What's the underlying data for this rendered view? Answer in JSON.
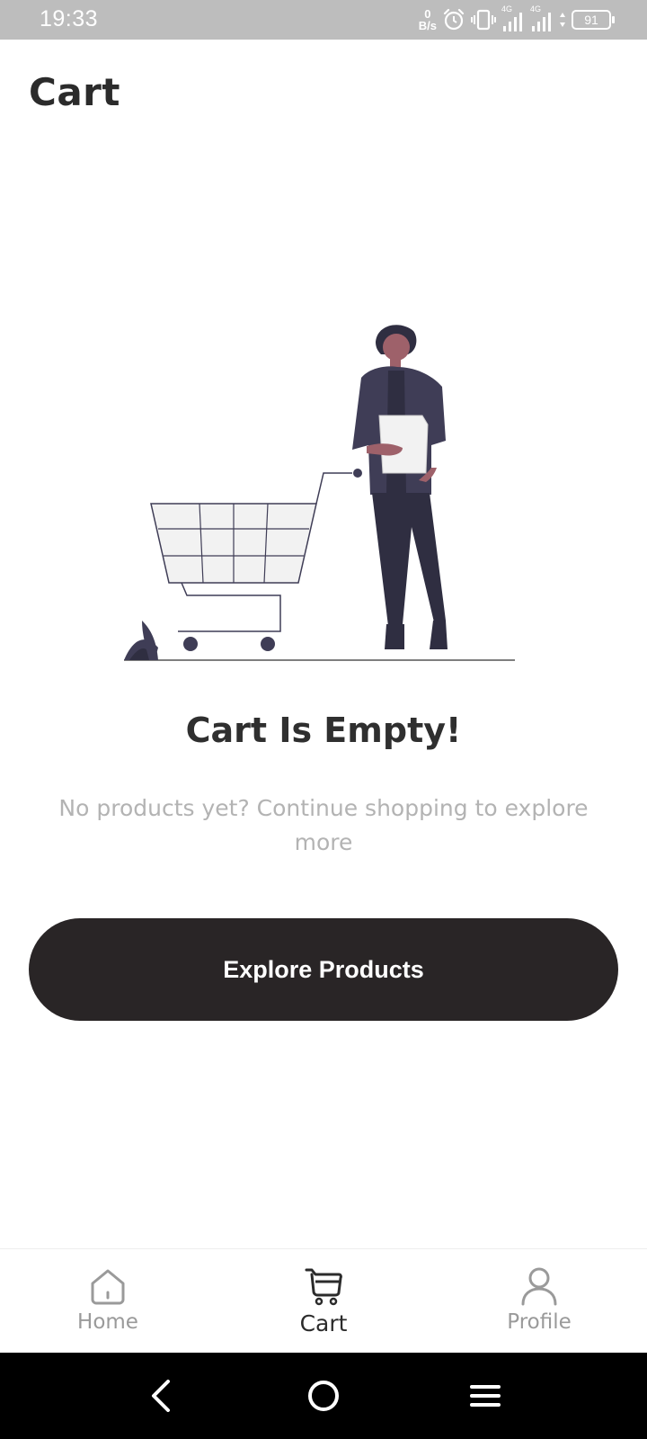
{
  "status_bar": {
    "time": "19:33",
    "net_speed_value": "0",
    "net_speed_unit": "B/s",
    "sim1_tag": "4G",
    "sim2_tag": "4G",
    "battery_level": "91"
  },
  "header": {
    "title": "Cart"
  },
  "empty_state": {
    "title": "Cart Is Empty!",
    "subtitle": "No products yet? Continue shopping to explore more",
    "button_label": "Explore Products"
  },
  "bottom_nav": {
    "items": [
      {
        "label": "Home",
        "icon": "home-icon",
        "active": false
      },
      {
        "label": "Cart",
        "icon": "cart-icon",
        "active": true
      },
      {
        "label": "Profile",
        "icon": "profile-icon",
        "active": false
      }
    ]
  },
  "system_nav": {
    "items": [
      "back-icon",
      "home-circle-icon",
      "menu-icon"
    ]
  },
  "colors": {
    "primary_dark": "#292526",
    "text_dark": "#2b2b2b",
    "text_muted": "#b3b3b3",
    "status_bar": "#bdbdbd",
    "illustration_person": "#3f3d56",
    "illustration_skin": "#9e616a"
  }
}
